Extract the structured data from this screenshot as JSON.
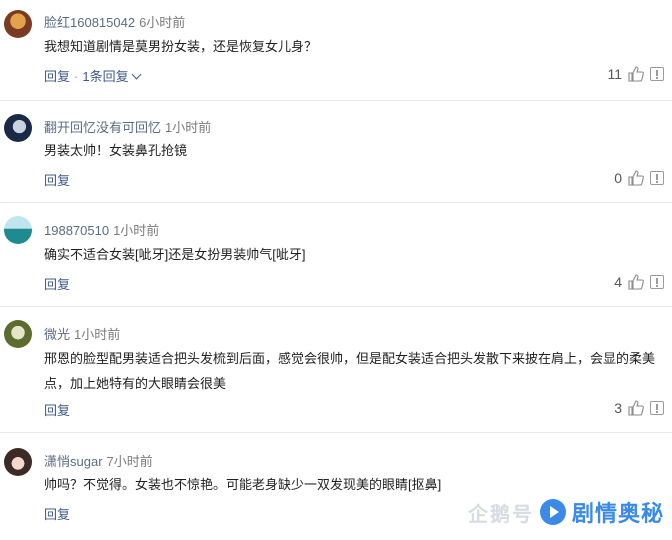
{
  "comments": [
    {
      "username": "脸红160815042",
      "time": "6小时前",
      "text": "我想知道剧情是莫男扮女装，还是恢复女儿身？",
      "reply": "回复",
      "replies_count": "1条回复",
      "likes": "11",
      "avatar_colors": [
        "#7a3b24",
        "#e3a34a"
      ]
    },
    {
      "username": "翻开回忆没有可回忆",
      "time": "1小时前",
      "text": "男装太帅！女装鼻孔抢镜",
      "reply": "回复",
      "likes": "0",
      "avatar_colors": [
        "#1b2a44",
        "#c9d3df"
      ]
    },
    {
      "username": "198870510",
      "time": "1小时前",
      "text": "确实不适合女装[呲牙]还是女扮男装帅气[呲牙]",
      "reply": "回复",
      "likes": "4",
      "avatar_colors": [
        "#1f8a8f",
        "#bfe6ee"
      ]
    },
    {
      "username": "微光",
      "time": "1小时前",
      "text": "邢恩的脸型配男装适合把头发梳到后面，感觉会很帅，但是配女装适合把头发散下来披在肩上，会显的柔美点，加上她特有的大眼睛会很美",
      "reply": "回复",
      "likes": "3",
      "avatar_colors": [
        "#5c6b2e",
        "#e2e6c4"
      ]
    },
    {
      "username": "潇悄sugar",
      "time": "7小时前",
      "text": "帅吗？不觉得。女装也不惊艳。可能老身缺少一双发现美的眼睛[抠鼻]",
      "reply": "回复",
      "likes": "",
      "avatar_colors": [
        "#3b2a25",
        "#f1d9cc"
      ]
    }
  ],
  "watermark": {
    "faint": "企鹅号",
    "brand": "剧情奥秘",
    "brand_color": "#3a8ae6"
  }
}
